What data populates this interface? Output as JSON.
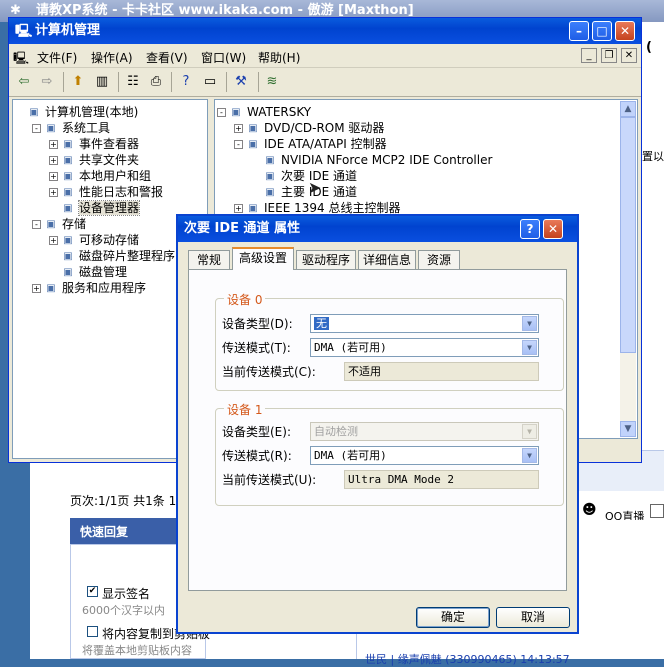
{
  "browser": {
    "title": "请教XP系统 - 卡卡社区 www.ikaka.com - 傲游 [Maxthon]",
    "page_info": "页次:1/1页 共1条 1",
    "reply_header": "快速回复",
    "show_signature": "显示签名",
    "char_limit": "6000个汉字以内",
    "copy_clipboard": "将内容复制到剪贴板",
    "overwrite_note": "将覆盖本地剪贴板内容",
    "qq_live": "QQ直播",
    "bottom_user": "世民 | 缘声佩魅 (330990465) 14:13:57",
    "right_fragment_1": "(",
    "right_fragment_2": "置以"
  },
  "computer_management": {
    "title": "计算机管理",
    "menu": [
      "文件(F)",
      "操作(A)",
      "查看(V)",
      "窗口(W)",
      "帮助(H)"
    ],
    "left_tree": [
      {
        "label": "计算机管理(本地)",
        "icon": "computer-icon",
        "indent": 0,
        "expander": ""
      },
      {
        "label": "系统工具",
        "icon": "tools-icon",
        "indent": 1,
        "expander": "-"
      },
      {
        "label": "事件查看器",
        "icon": "event-viewer-icon",
        "indent": 2,
        "expander": "+"
      },
      {
        "label": "共享文件夹",
        "icon": "shared-folder-icon",
        "indent": 2,
        "expander": "+"
      },
      {
        "label": "本地用户和组",
        "icon": "users-icon",
        "indent": 2,
        "expander": "+"
      },
      {
        "label": "性能日志和警报",
        "icon": "performance-icon",
        "indent": 2,
        "expander": "+"
      },
      {
        "label": "设备管理器",
        "icon": "device-manager-icon",
        "indent": 2,
        "expander": ""
      },
      {
        "label": "存储",
        "icon": "storage-icon",
        "indent": 1,
        "expander": "-"
      },
      {
        "label": "可移动存储",
        "icon": "removable-storage-icon",
        "indent": 2,
        "expander": "+"
      },
      {
        "label": "磁盘碎片整理程序",
        "icon": "defrag-icon",
        "indent": 2,
        "expander": ""
      },
      {
        "label": "磁盘管理",
        "icon": "disk-management-icon",
        "indent": 2,
        "expander": ""
      },
      {
        "label": "服务和应用程序",
        "icon": "services-icon",
        "indent": 1,
        "expander": "+"
      }
    ],
    "right_tree": [
      {
        "label": "WATERSKY",
        "icon": "computer-icon",
        "indent": 0,
        "expander": "-"
      },
      {
        "label": "DVD/CD-ROM 驱动器",
        "icon": "cdrom-icon",
        "indent": 1,
        "expander": "+"
      },
      {
        "label": "IDE ATA/ATAPI 控制器",
        "icon": "ide-controller-icon",
        "indent": 1,
        "expander": "-"
      },
      {
        "label": "NVIDIA NForce MCP2 IDE Controller",
        "icon": "ide-channel-icon",
        "indent": 2,
        "expander": ""
      },
      {
        "label": "次要 IDE 通道",
        "icon": "ide-channel-icon",
        "indent": 2,
        "expander": ""
      },
      {
        "label": "主要 IDE 通道",
        "icon": "ide-channel-icon",
        "indent": 2,
        "expander": ""
      },
      {
        "label": "IEEE 1394 总线主控制器",
        "icon": "ieee1394-icon",
        "indent": 1,
        "expander": "+"
      }
    ]
  },
  "dialog": {
    "title": "次要 IDE 通道 属性",
    "tabs": [
      "常规",
      "高级设置",
      "驱动程序",
      "详细信息",
      "资源"
    ],
    "active_tab": "高级设置",
    "device0": {
      "group": "设备 0",
      "type_label": "设备类型(D):",
      "type_value": "无",
      "mode_label": "传送模式(T):",
      "mode_value": "DMA (若可用)",
      "current_label": "当前传送模式(C):",
      "current_value": "不适用"
    },
    "device1": {
      "group": "设备 1",
      "type_label": "设备类型(E):",
      "type_value": "自动检测",
      "mode_label": "传送模式(R):",
      "mode_value": "DMA (若可用)",
      "current_label": "当前传送模式(U):",
      "current_value": "Ultra DMA Mode 2"
    },
    "ok": "确定",
    "cancel": "取消"
  }
}
